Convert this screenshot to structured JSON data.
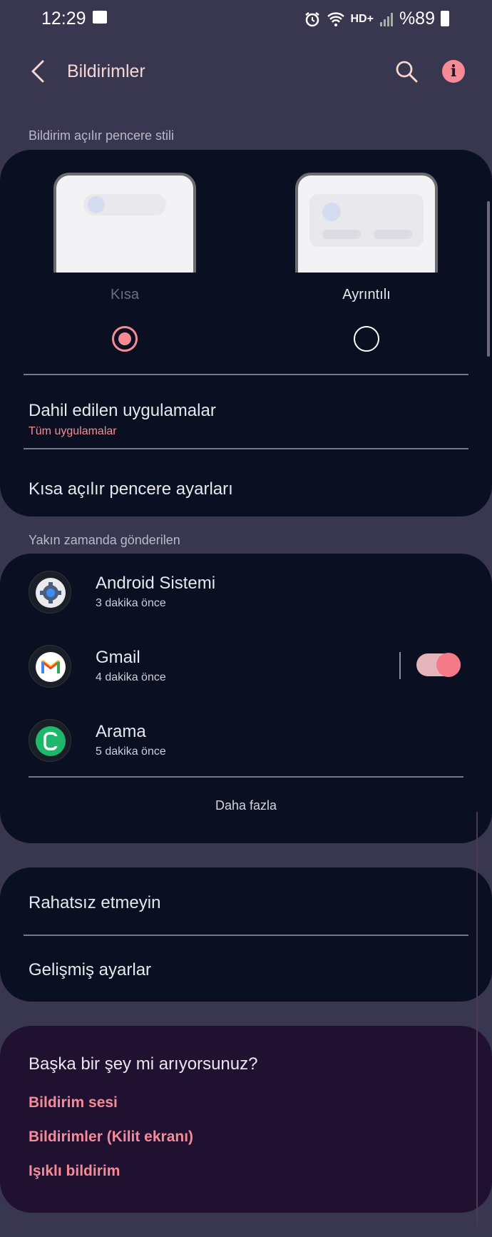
{
  "status": {
    "time": "12:29",
    "hd": "HD+",
    "battery": "%89"
  },
  "header": {
    "title": "Bildirimler",
    "info_glyph": "i"
  },
  "popup_style": {
    "section_label": "Bildirim açılır pencere stili",
    "options": [
      {
        "label": "Kısa",
        "selected": true
      },
      {
        "label": "Ayrıntılı",
        "selected": false
      }
    ],
    "included_apps": {
      "title": "Dahil edilen uygulamalar",
      "value": "Tüm uygulamalar"
    },
    "brief_settings": "Kısa açılır pencere ayarları"
  },
  "recent": {
    "section_label": "Yakın zamanda gönderilen",
    "apps": [
      {
        "name": "Android Sistemi",
        "time": "3 dakika önce",
        "icon": "gear-icon"
      },
      {
        "name": "Gmail",
        "time": "4 dakika önce",
        "icon": "gmail-icon",
        "enabled": true
      },
      {
        "name": "Arama",
        "time": "5 dakika önce",
        "icon": "phone-icon"
      }
    ],
    "more": "Daha fazla"
  },
  "settings": {
    "dnd": "Rahatsız etmeyin",
    "advanced": "Gelişmiş ayarlar"
  },
  "suggest": {
    "title": "Başka bir şey mi arıyorsunuz?",
    "links": [
      "Bildirim sesi",
      "Bildirimler (Kilit ekranı)",
      "Işıklı bildirim"
    ]
  },
  "colors": {
    "accent": "#f68b95",
    "background": "#393650",
    "card": "#0a1022",
    "suggest_card": "#211131"
  }
}
